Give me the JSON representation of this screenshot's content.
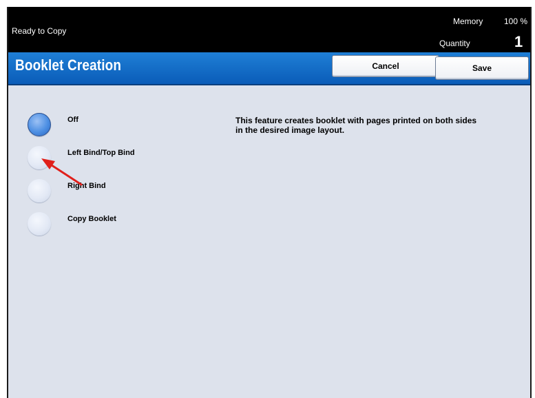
{
  "status": {
    "ready_text": "Ready to Copy",
    "memory_label": "Memory",
    "memory_value": "100 %",
    "quantity_label": "Quantity",
    "quantity_value": "1"
  },
  "header": {
    "title": "Booklet Creation",
    "cancel_label": "Cancel",
    "save_label": "Save"
  },
  "options": [
    {
      "label": "Off",
      "selected": true
    },
    {
      "label": "Left Bind/Top Bind",
      "selected": false
    },
    {
      "label": "Right Bind",
      "selected": false
    },
    {
      "label": "Copy Booklet",
      "selected": false
    }
  ],
  "description": "This feature creates booklet with pages printed on both sides in the desired image layout.",
  "colors": {
    "title_bar": "#0a5cb8",
    "background": "#dde2ec",
    "annotation_arrow": "#e0201b"
  }
}
